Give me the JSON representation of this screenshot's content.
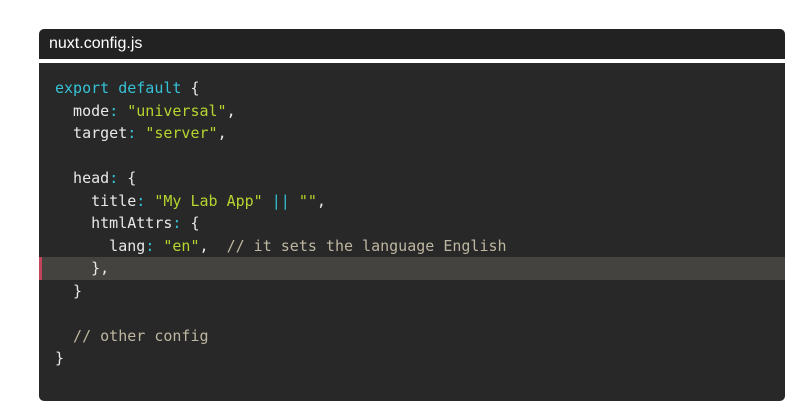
{
  "file": {
    "name": "nuxt.config.js"
  },
  "colors": {
    "title_bar_bg": "#222222",
    "code_bg": "#282828",
    "highlight_bg": "#454340",
    "highlight_marker": "#c0445a",
    "keyword": "#35c2d6",
    "string": "#b5d52f",
    "comment": "#bdb6a0"
  },
  "code": {
    "highlighted_line": 9,
    "lines": [
      [
        {
          "t": "kw",
          "v": "export default "
        },
        {
          "t": "pun",
          "v": "{"
        }
      ],
      [
        {
          "t": "prop",
          "v": "  mode"
        },
        {
          "t": "op",
          "v": ": "
        },
        {
          "t": "str",
          "v": "\"universal\""
        },
        {
          "t": "pun",
          "v": ","
        }
      ],
      [
        {
          "t": "prop",
          "v": "  target"
        },
        {
          "t": "op",
          "v": ": "
        },
        {
          "t": "str",
          "v": "\"server\""
        },
        {
          "t": "pun",
          "v": ","
        }
      ],
      [],
      [
        {
          "t": "prop",
          "v": "  head"
        },
        {
          "t": "op",
          "v": ": "
        },
        {
          "t": "pun",
          "v": "{"
        }
      ],
      [
        {
          "t": "prop",
          "v": "    title"
        },
        {
          "t": "op",
          "v": ": "
        },
        {
          "t": "str",
          "v": "\"My Lab App\""
        },
        {
          "t": "op",
          "v": " || "
        },
        {
          "t": "str",
          "v": "\"\""
        },
        {
          "t": "pun",
          "v": ","
        }
      ],
      [
        {
          "t": "prop",
          "v": "    htmlAttrs"
        },
        {
          "t": "op",
          "v": ": "
        },
        {
          "t": "pun",
          "v": "{"
        }
      ],
      [
        {
          "t": "prop",
          "v": "      lang"
        },
        {
          "t": "op",
          "v": ": "
        },
        {
          "t": "str",
          "v": "\"en\""
        },
        {
          "t": "pun",
          "v": ",  "
        },
        {
          "t": "cmt",
          "v": "// it sets the language English"
        }
      ],
      [
        {
          "t": "pun",
          "v": "    },"
        }
      ],
      [
        {
          "t": "pun",
          "v": "  }"
        }
      ],
      [],
      [
        {
          "t": "cmt",
          "v": "  // other config"
        }
      ],
      [
        {
          "t": "pun",
          "v": "}"
        }
      ]
    ]
  }
}
